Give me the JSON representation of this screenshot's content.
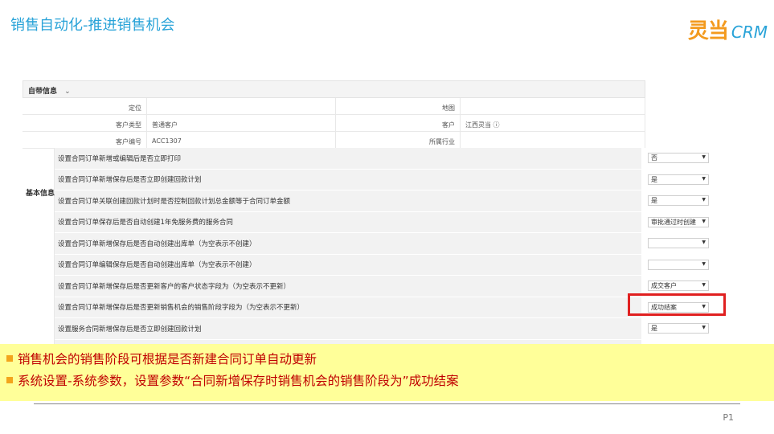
{
  "slide": {
    "title": "销售自动化-推进销售机会",
    "logo_cn": "灵当",
    "logo_en": "CRM",
    "page": "P1"
  },
  "section": {
    "header": "自带信息",
    "chevron": "⌄",
    "side_label": "基本信息"
  },
  "info_rows": [
    {
      "label": "定位",
      "value": "",
      "label2": "地图",
      "value2": ""
    },
    {
      "label": "客户类型",
      "value": "普通客户",
      "label2": "客户",
      "value2": "江西灵当 ⓘ"
    },
    {
      "label": "客户编号",
      "value": "ACC1307",
      "label2": "所属行业",
      "value2": ""
    }
  ],
  "params": [
    {
      "desc": "设置合同订单新增或编辑后是否立即打印",
      "value": "否"
    },
    {
      "desc": "设置合同订单新增保存后是否立即创建回款计划",
      "value": "是"
    },
    {
      "desc": "设置合同订单关联创建回款计划时是否控制回款计划总金额等于合同订单金额",
      "value": "是"
    },
    {
      "desc": "设置合同订单保存后是否自动创建1年免服务费的服务合同",
      "value": "审批通过时创建"
    },
    {
      "desc": "设置合同订单新增保存后是否自动创建出库单（为空表示不创建）",
      "value": ""
    },
    {
      "desc": "设置合同订单编辑保存后是否自动创建出库单（为空表示不创建）",
      "value": ""
    },
    {
      "desc": "设置合同订单新增保存后是否更新客户的客户状态字段为（为空表示不更新）",
      "value": "成交客户"
    },
    {
      "desc": "设置合同订单新增保存后是否更新销售机会的销售阶段字段为（为空表示不更新）",
      "value": "成功结案"
    },
    {
      "desc": "设置服务合同新增保存后是否立即创建回款计划",
      "value": "是"
    },
    {
      "desc": "",
      "value": ""
    }
  ],
  "callout": {
    "bullet1": "销售机会的销售阶段可根据是否新建合同订单自动更新",
    "bullet2": "系统设置-系统参数，设置参数“合同新增保存时销售机会的销售阶段为”成功结案"
  },
  "colors": {
    "title": "#29a3d8",
    "logo_cn": "#f39a1e",
    "callout_bg": "#ffff99",
    "callout_text": "#c00000",
    "highlight": "#e02020"
  }
}
